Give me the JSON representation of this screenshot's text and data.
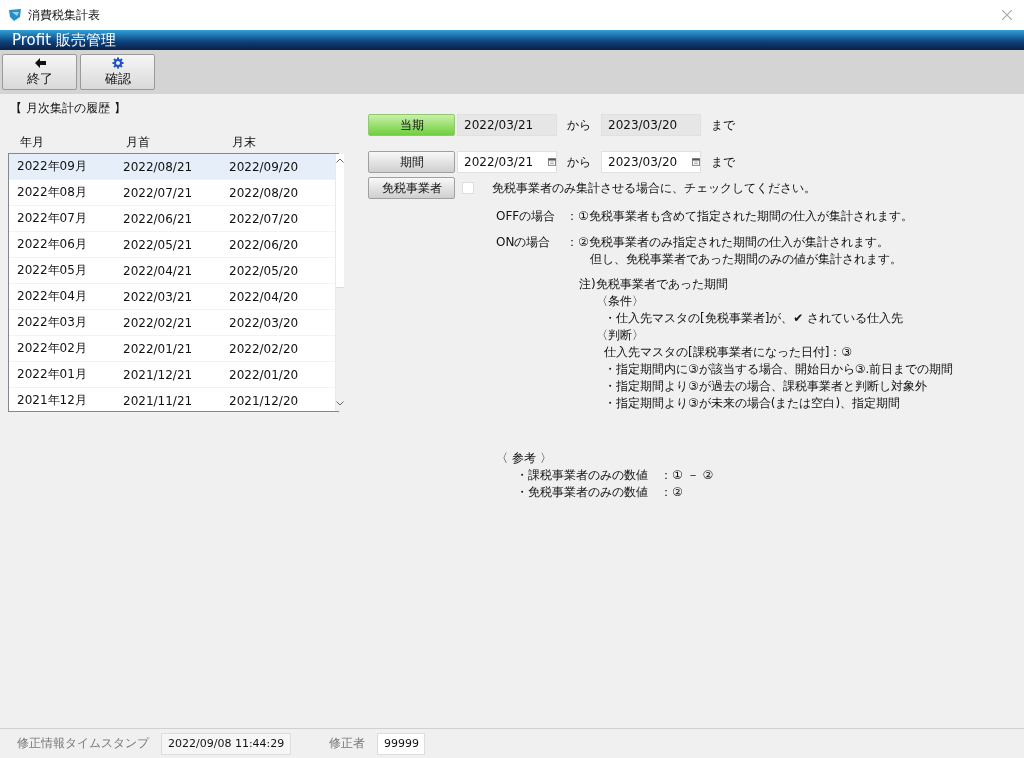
{
  "window": {
    "title": "消費税集計表"
  },
  "app_header": {
    "title": "Profit 販売管理"
  },
  "toolbar": [
    {
      "kind": "exit",
      "label": "終了"
    },
    {
      "kind": "confirm",
      "label": "確認"
    }
  ],
  "history": {
    "heading": "【 月次集計の履歴 】",
    "columns": [
      "年月",
      "月首",
      "月末"
    ],
    "rows": [
      {
        "month": "2022年09月",
        "start": "2022/08/21",
        "end": "2022/09/20",
        "selected": true
      },
      {
        "month": "2022年08月",
        "start": "2022/07/21",
        "end": "2022/08/20",
        "selected": false
      },
      {
        "month": "2022年07月",
        "start": "2022/06/21",
        "end": "2022/07/20",
        "selected": false
      },
      {
        "month": "2022年06月",
        "start": "2022/05/21",
        "end": "2022/06/20",
        "selected": false
      },
      {
        "month": "2022年05月",
        "start": "2022/04/21",
        "end": "2022/05/20",
        "selected": false
      },
      {
        "month": "2022年04月",
        "start": "2022/03/21",
        "end": "2022/04/20",
        "selected": false
      },
      {
        "month": "2022年03月",
        "start": "2022/02/21",
        "end": "2022/03/20",
        "selected": false
      },
      {
        "month": "2022年02月",
        "start": "2022/01/21",
        "end": "2022/02/20",
        "selected": false
      },
      {
        "month": "2022年01月",
        "start": "2021/12/21",
        "end": "2022/01/20",
        "selected": false
      },
      {
        "month": "2021年12月",
        "start": "2021/11/21",
        "end": "2021/12/20",
        "selected": false
      }
    ]
  },
  "periods": [
    {
      "kind": "readonly",
      "button": "当期",
      "selected": true,
      "from": "2022/03/21",
      "from_label": "から",
      "to": "2023/03/20",
      "to_label": "まで"
    },
    {
      "kind": "picker",
      "button": "期間",
      "selected": false,
      "from": "2022/03/21",
      "from_label": "から",
      "to": "2023/03/20",
      "to_label": "まで"
    }
  ],
  "tax_exempt": {
    "button": "免税事業者",
    "checked": false,
    "instruction": "免税事業者のみ集計させる場合に、チェックしてください。"
  },
  "cases": [
    {
      "label": "OFFの場合",
      "lines": [
        "：①免税事業者も含めて指定された期間の仕入が集計されます。"
      ]
    },
    {
      "label": "ONの場合",
      "lines": [
        "：②免税事業者のみ指定された期間の仕入が集計されます。",
        "但し、免税事業者であった期間のみの値が集計されます。"
      ]
    }
  ],
  "note": {
    "title": "注)免税事業者であった期間",
    "sections": [
      {
        "heading": "〈条件〉",
        "items": [
          "・仕入先マスタの[免税事業者]が、✔ されている仕入先"
        ]
      },
      {
        "heading": "〈判断〉",
        "items": [
          "仕入先マスタの[課税事業者になった日付]：③",
          "・指定期間内に③が該当する場合、開始日から③.前日までの期間",
          "・指定期間より③が過去の場合、課税事業者と判断し対象外",
          "・指定期間より③が未来の場合(または空白)、指定期間"
        ]
      }
    ]
  },
  "reference": {
    "heading": "〈 参考 〉",
    "items": [
      {
        "label": "・課税事業者のみの数値",
        "value": "：① － ②"
      },
      {
        "label": "・免税事業者のみの数値",
        "value": "：②"
      }
    ]
  },
  "footer": {
    "timestamp_label": "修正情報タイムスタンプ",
    "timestamp": "2022/09/08 11:44:29",
    "editor_label": "修正者",
    "editor": "99999"
  }
}
